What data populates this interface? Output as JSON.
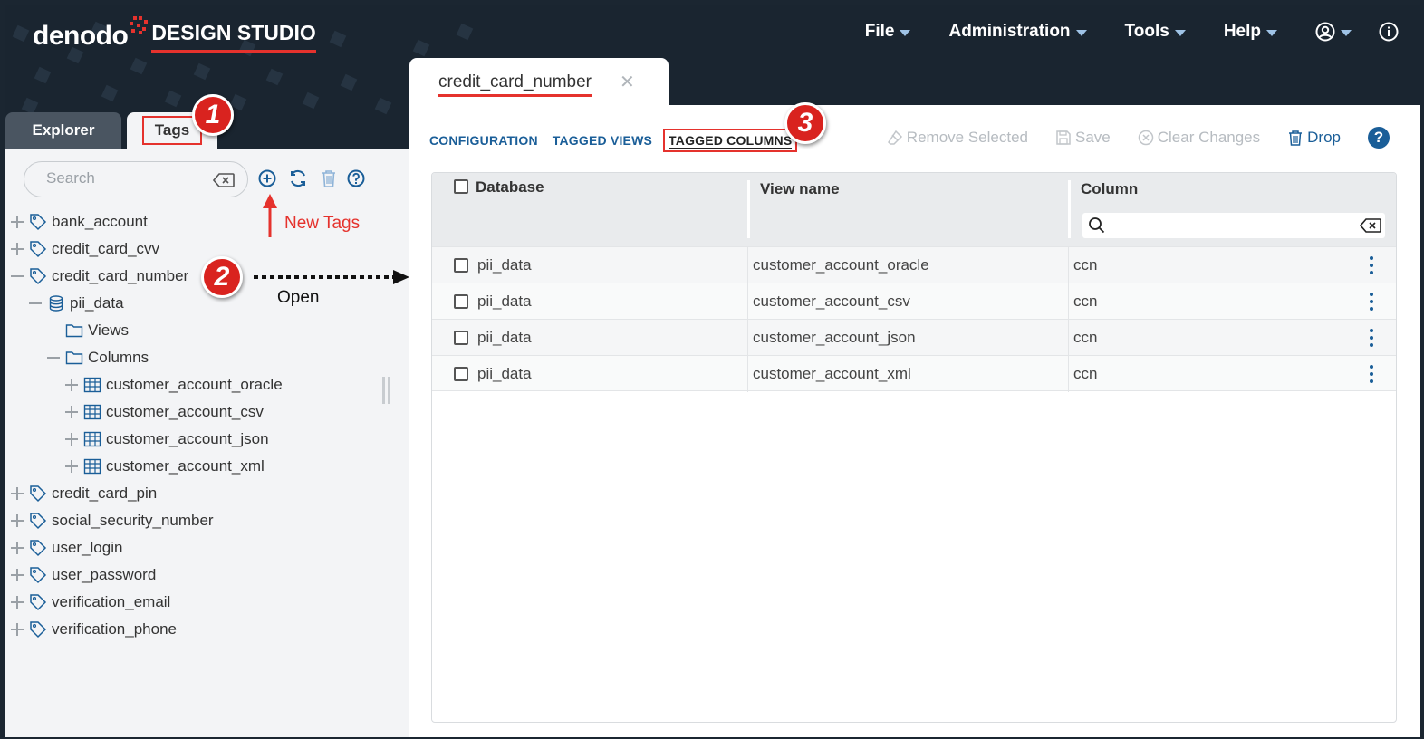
{
  "app": {
    "brand": "denodo",
    "product": "DESIGN STUDIO"
  },
  "menu": {
    "file": "File",
    "administration": "Administration",
    "tools": "Tools",
    "help": "Help"
  },
  "left_tabs": {
    "explorer": "Explorer",
    "tags": "Tags"
  },
  "search": {
    "placeholder": "Search"
  },
  "tree": {
    "bank_account": "bank_account",
    "credit_card_cvv": "credit_card_cvv",
    "credit_card_number": "credit_card_number",
    "pii_data": "pii_data",
    "views": "Views",
    "columns": "Columns",
    "cao": "customer_account_oracle",
    "cac": "customer_account_csv",
    "caj": "customer_account_json",
    "cax": "customer_account_xml",
    "credit_card_pin": "credit_card_pin",
    "social_security_number": "social_security_number",
    "user_login": "user_login",
    "user_password": "user_password",
    "verification_email": "verification_email",
    "verification_phone": "verification_phone"
  },
  "annotations": {
    "badge1": "1",
    "badge2": "2",
    "badge3": "3",
    "new_tags": "New Tags",
    "open": "Open"
  },
  "doc_tab": {
    "title": "credit_card_number",
    "close": "✕"
  },
  "subtabs": {
    "configuration": "CONFIGURATION",
    "tagged_views": "TAGGED VIEWS",
    "tagged_columns": "TAGGED COLUMNS"
  },
  "actions": {
    "remove_selected": "Remove Selected",
    "save": "Save",
    "clear_changes": "Clear Changes",
    "drop": "Drop",
    "help": "?"
  },
  "grid": {
    "headers": {
      "database": "Database",
      "view_name": "View name",
      "column": "Column"
    },
    "rows": [
      {
        "database": "pii_data",
        "view": "customer_account_oracle",
        "column": "ccn"
      },
      {
        "database": "pii_data",
        "view": "customer_account_csv",
        "column": "ccn"
      },
      {
        "database": "pii_data",
        "view": "customer_account_json",
        "column": "ccn"
      },
      {
        "database": "pii_data",
        "view": "customer_account_xml",
        "column": "ccn"
      }
    ]
  },
  "colors": {
    "header_bg": "#1a2530",
    "accent_red": "#e5322d",
    "link_blue": "#1a5e98",
    "panel_bg": "#f3f4f6"
  }
}
